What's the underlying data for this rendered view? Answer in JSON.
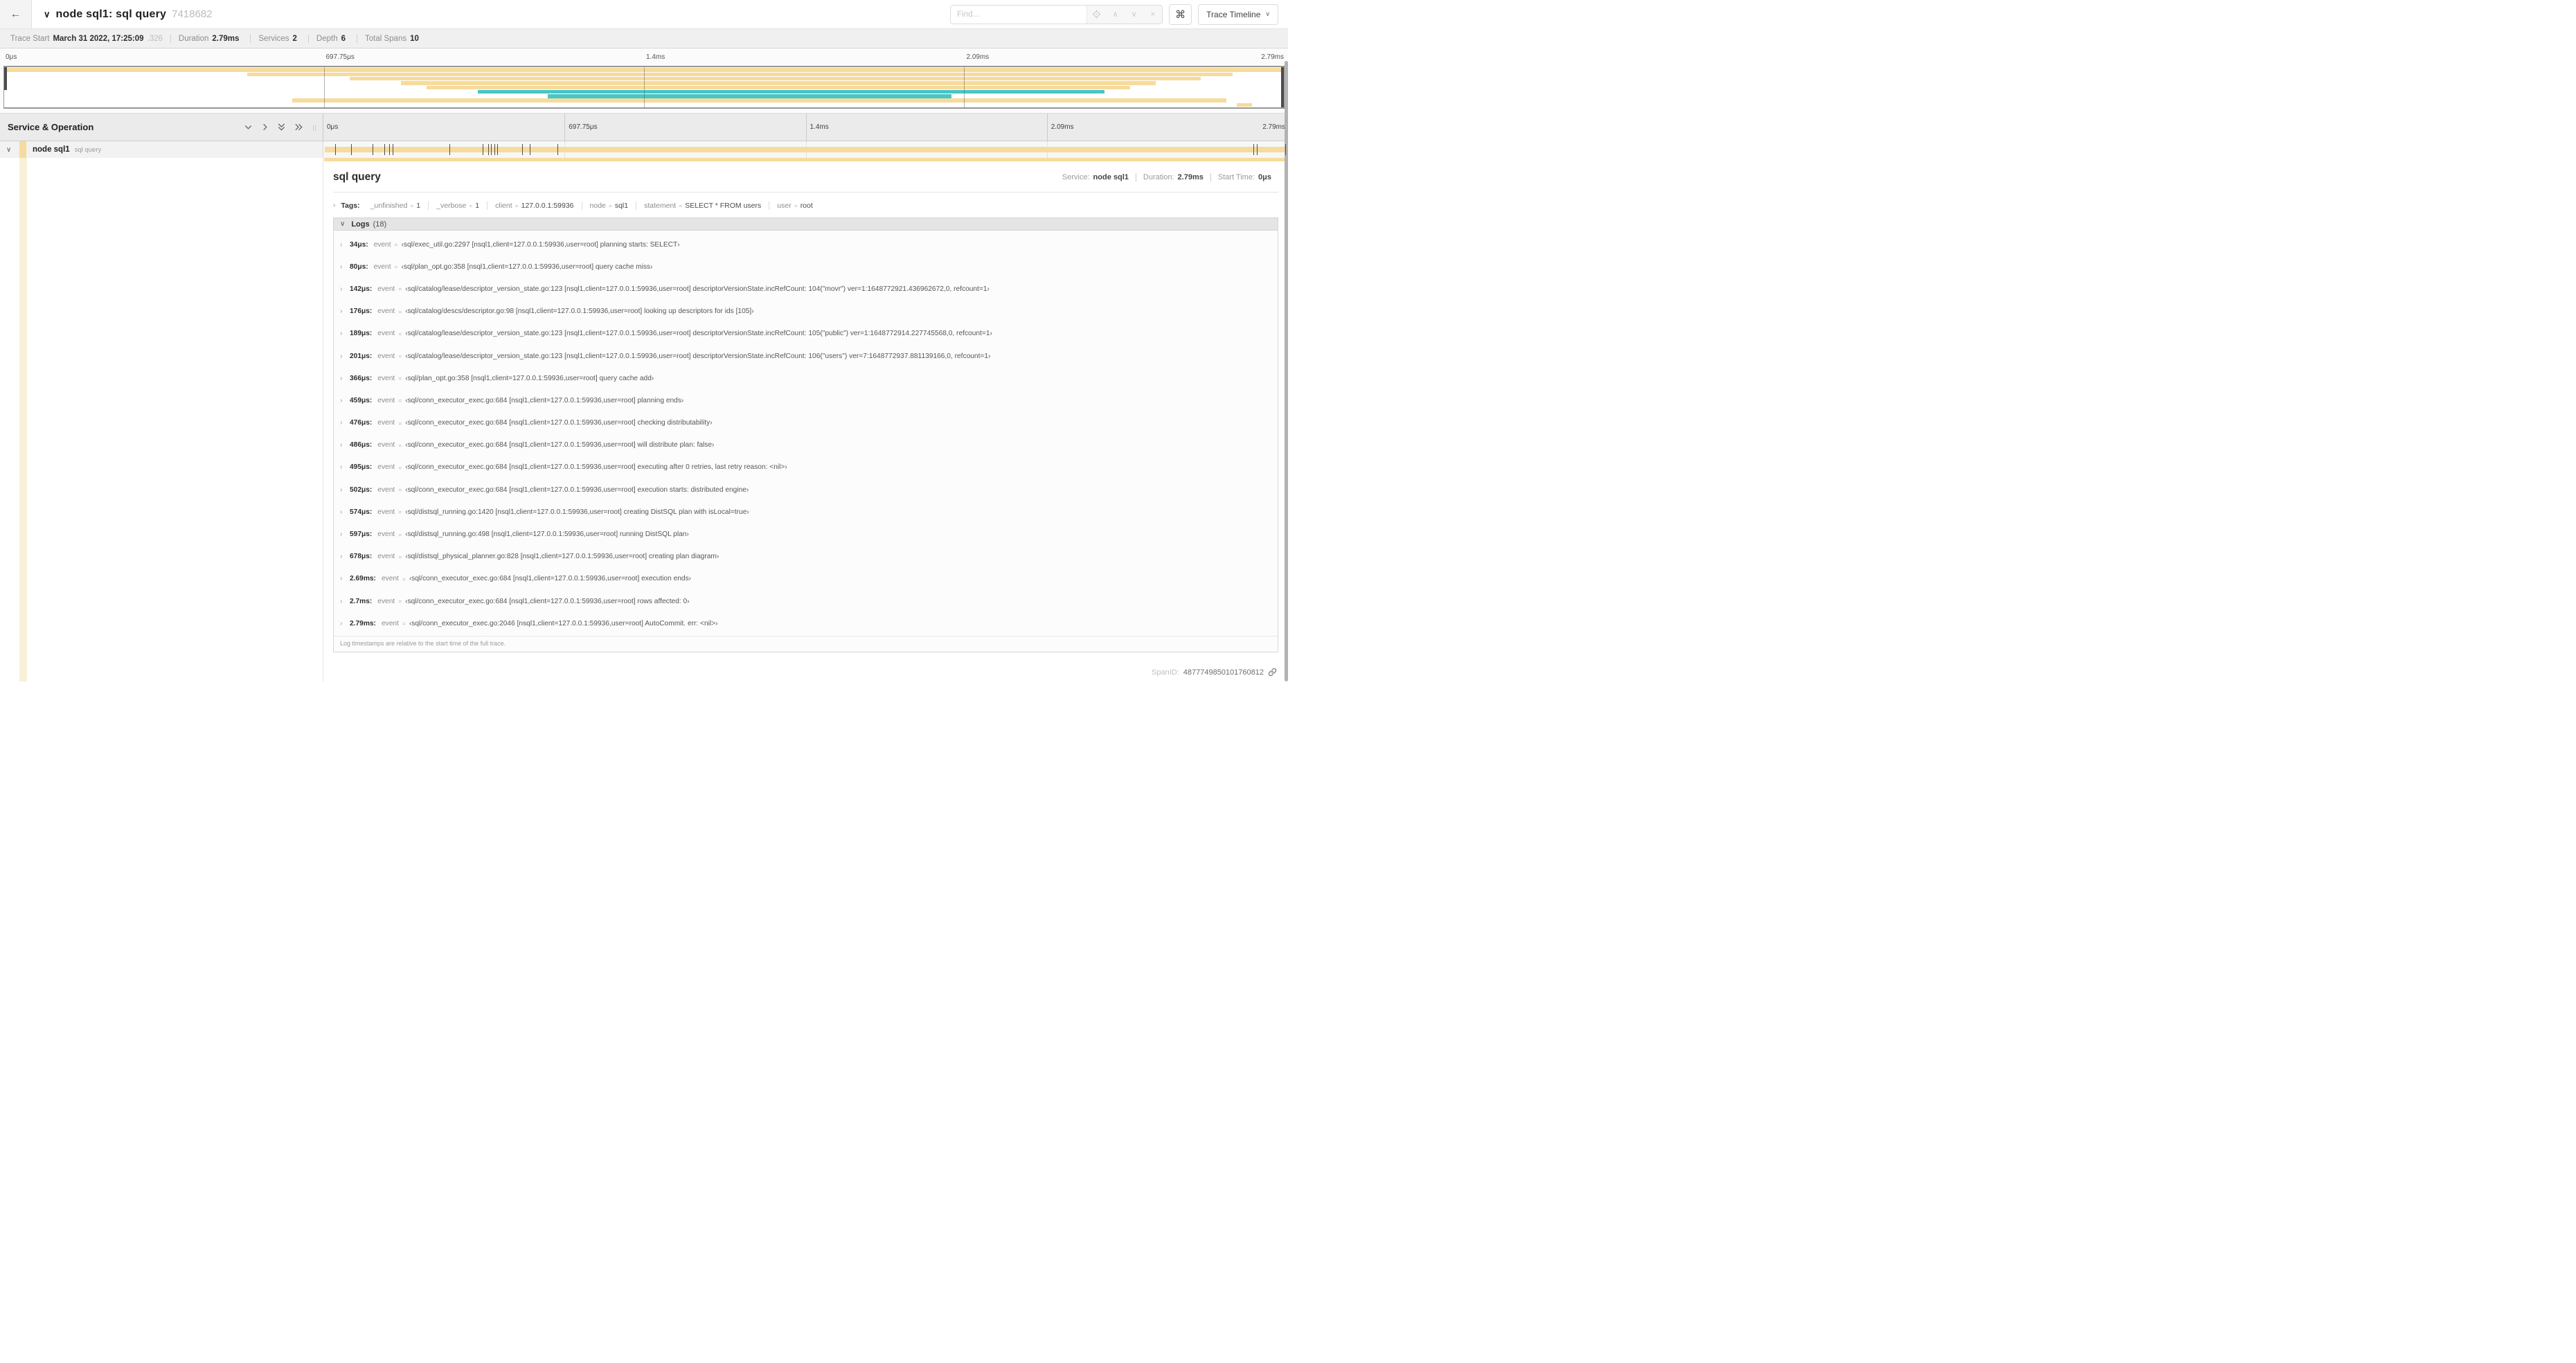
{
  "icons": {
    "back": "←",
    "chevron_down": "∨",
    "chevron_right": "›",
    "search_prev": "∧",
    "search_next": "∨",
    "clear": "×",
    "keyboard": "⌘",
    "grip": "||"
  },
  "colors": {
    "span_tan": "#F6DB9C",
    "span_teal": "#47C5C7",
    "span_cream": "#FAF0D9"
  },
  "header": {
    "title": "node sql1: sql query",
    "trace_id": "7418682",
    "find_placeholder": "Find...",
    "view_selector": "Trace Timeline"
  },
  "trace_meta": {
    "items": [
      {
        "label": "Trace Start",
        "value": "March 31 2022, 17:25:09",
        "suffix": ".326"
      },
      {
        "label": "Duration",
        "value": "2.79ms",
        "suffix": ""
      },
      {
        "label": "Services",
        "value": "2",
        "suffix": ""
      },
      {
        "label": "Depth",
        "value": "6",
        "suffix": ""
      },
      {
        "label": "Total Spans",
        "value": "10",
        "suffix": ""
      }
    ]
  },
  "timeline": {
    "ticks": [
      {
        "label": "0μs",
        "pos": 0,
        "edge": "first"
      },
      {
        "label": "697.75μs",
        "pos": 25,
        "edge": ""
      },
      {
        "label": "1.4ms",
        "pos": 50,
        "edge": ""
      },
      {
        "label": "2.09ms",
        "pos": 75,
        "edge": ""
      }
    ],
    "end_tick": "2.79ms",
    "minimap_rows": [
      {
        "start": 0,
        "width": 100,
        "color": "tan"
      },
      {
        "start": 19,
        "width": 77,
        "color": "tan"
      },
      {
        "start": 27,
        "width": 66.5,
        "color": "tan"
      },
      {
        "start": 31,
        "width": 59,
        "color": "tan"
      },
      {
        "start": 33,
        "width": 55,
        "color": "tan"
      },
      {
        "start": 37,
        "width": 49,
        "color": "teal"
      },
      {
        "start": 42.5,
        "width": 31.5,
        "color": "teal"
      },
      {
        "start": 22.5,
        "width": 73,
        "color": "tan"
      },
      {
        "start": 96.3,
        "width": 1.2,
        "color": "tan"
      }
    ],
    "log_markers": [
      {
        "pos": 1.2
      },
      {
        "pos": 2.9
      },
      {
        "pos": 5.1
      },
      {
        "pos": 6.3
      },
      {
        "pos": 6.8
      },
      {
        "pos": 7.2
      },
      {
        "pos": 13.1
      },
      {
        "pos": 16.5
      },
      {
        "pos": 17.1
      },
      {
        "pos": 17.4
      },
      {
        "pos": 17.7
      },
      {
        "pos": 18.0
      },
      {
        "pos": 20.6
      },
      {
        "pos": 21.4
      },
      {
        "pos": 24.3
      },
      {
        "pos": 96.4
      },
      {
        "pos": 96.8
      },
      {
        "pos": 99.7
      }
    ]
  },
  "span_table": {
    "header": "Service & Operation",
    "row": {
      "service": "node sql1",
      "operation": "sql query"
    }
  },
  "detail": {
    "title": "sql query",
    "meta": [
      {
        "label": "Service:",
        "value": "node sql1"
      },
      {
        "label": "Duration:",
        "value": "2.79ms"
      },
      {
        "label": "Start Time:",
        "value": "0μs"
      }
    ],
    "tags_label": "Tags:",
    "equals": "=",
    "tags": [
      {
        "key": "_unfinished",
        "value": "1"
      },
      {
        "key": "_verbose",
        "value": "1"
      },
      {
        "key": "client",
        "value": "127.0.0.1:59936"
      },
      {
        "key": "node",
        "value": "sql1"
      },
      {
        "key": "statement",
        "value": "SELECT * FROM users"
      },
      {
        "key": "user",
        "value": "root"
      }
    ],
    "logs_label": "Logs",
    "logs_count": "(18)",
    "log_field": "event",
    "logs": [
      {
        "time": "34μs:",
        "value": "‹sql/exec_util.go:2297 [nsql1,client=127.0.0.1:59936,user=root] planning starts: SELECT›"
      },
      {
        "time": "80μs:",
        "value": "‹sql/plan_opt.go:358 [nsql1,client=127.0.0.1:59936,user=root] query cache miss›"
      },
      {
        "time": "142μs:",
        "value": "‹sql/catalog/lease/descriptor_version_state.go:123 [nsql1,client=127.0.0.1:59936,user=root] descriptorVersionState.incRefCount: 104(\"movr\") ver=1:1648772921.436962672,0, refcount=1›"
      },
      {
        "time": "176μs:",
        "value": "‹sql/catalog/descs/descriptor.go:98 [nsql1,client=127.0.0.1:59936,user=root] looking up descriptors for ids [105]›"
      },
      {
        "time": "189μs:",
        "value": "‹sql/catalog/lease/descriptor_version_state.go:123 [nsql1,client=127.0.0.1:59936,user=root] descriptorVersionState.incRefCount: 105(\"public\") ver=1:1648772914.227745568,0, refcount=1›"
      },
      {
        "time": "201μs:",
        "value": "‹sql/catalog/lease/descriptor_version_state.go:123 [nsql1,client=127.0.0.1:59936,user=root] descriptorVersionState.incRefCount: 106(\"users\") ver=7:1648772937.881139166,0, refcount=1›"
      },
      {
        "time": "366μs:",
        "value": "‹sql/plan_opt.go:358 [nsql1,client=127.0.0.1:59936,user=root] query cache add›"
      },
      {
        "time": "459μs:",
        "value": "‹sql/conn_executor_exec.go:684 [nsql1,client=127.0.0.1:59936,user=root] planning ends›"
      },
      {
        "time": "476μs:",
        "value": "‹sql/conn_executor_exec.go:684 [nsql1,client=127.0.0.1:59936,user=root] checking distributability›"
      },
      {
        "time": "486μs:",
        "value": "‹sql/conn_executor_exec.go:684 [nsql1,client=127.0.0.1:59936,user=root] will distribute plan: false›"
      },
      {
        "time": "495μs:",
        "value": "‹sql/conn_executor_exec.go:684 [nsql1,client=127.0.0.1:59936,user=root] executing after 0 retries, last retry reason: <nil>›"
      },
      {
        "time": "502μs:",
        "value": "‹sql/conn_executor_exec.go:684 [nsql1,client=127.0.0.1:59936,user=root] execution starts: distributed engine›"
      },
      {
        "time": "574μs:",
        "value": "‹sql/distsql_running.go:1420 [nsql1,client=127.0.0.1:59936,user=root] creating DistSQL plan with isLocal=true›"
      },
      {
        "time": "597μs:",
        "value": "‹sql/distsql_running.go:498 [nsql1,client=127.0.0.1:59936,user=root] running DistSQL plan›"
      },
      {
        "time": "678μs:",
        "value": "‹sql/distsql_physical_planner.go:828 [nsql1,client=127.0.0.1:59936,user=root] creating plan diagram›"
      },
      {
        "time": "2.69ms:",
        "value": "‹sql/conn_executor_exec.go:684 [nsql1,client=127.0.0.1:59936,user=root] execution ends›"
      },
      {
        "time": "2.7ms:",
        "value": "‹sql/conn_executor_exec.go:684 [nsql1,client=127.0.0.1:59936,user=root] rows affected: 0›"
      },
      {
        "time": "2.79ms:",
        "value": "‹sql/conn_executor_exec.go:2046 [nsql1,client=127.0.0.1:59936,user=root] AutoCommit. err: <nil>›"
      }
    ],
    "footer_note": "Log timestamps are relative to the start time of the full trace.",
    "span_id_label": "SpanID:",
    "span_id": "4877749850101760812"
  }
}
